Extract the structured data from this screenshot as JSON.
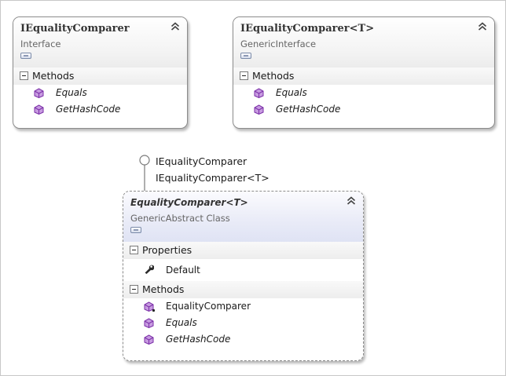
{
  "shapes": {
    "iequality": {
      "title": "IEqualityComparer",
      "subtitle": "Interface",
      "methods_label": "Methods",
      "methods": [
        "Equals",
        "GetHashCode"
      ]
    },
    "iequality_generic": {
      "title": "IEqualityComparer<T>",
      "subtitle": "GenericInterface",
      "methods_label": "Methods",
      "methods": [
        "Equals",
        "GetHashCode"
      ]
    },
    "equality_comparer": {
      "title": "EqualityComparer<T>",
      "subtitle": "GenericAbstract Class",
      "properties_label": "Properties",
      "properties": [
        "Default"
      ],
      "methods_label": "Methods",
      "methods": [
        "EqualityComparer",
        "Equals",
        "GetHashCode"
      ]
    }
  },
  "lollipop": {
    "interfaces": [
      "IEqualityComparer",
      "IEqualityComparer<T>"
    ]
  },
  "colors": {
    "method_icon": "#8a3fb5",
    "border": "#8c8c8c",
    "abstract_header": "#e2e6f6"
  },
  "icons": {
    "method": "purple-cube-icon",
    "property": "wrench-icon",
    "collapse": "double-chevron-up-icon",
    "toggle": "toggle-details-icon",
    "section": "minus-box-icon"
  }
}
